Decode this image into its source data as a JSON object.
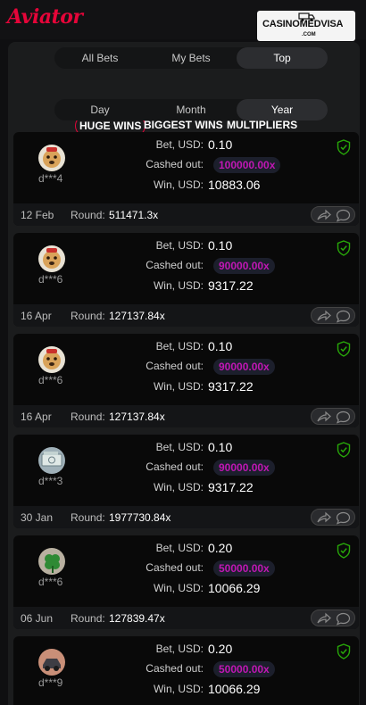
{
  "header": {
    "logo_text": "Aviator",
    "brand_name": "CASINOMEDVISA",
    "brand_domain": ".COM"
  },
  "tabs": {
    "items": [
      "All Bets",
      "My Bets",
      "Top"
    ],
    "active": 2
  },
  "filters": {
    "items": [
      "HUGE WINS",
      "BIGGEST WINS",
      "MULTIPLIERS"
    ],
    "active": 0
  },
  "periods": {
    "items": [
      "Day",
      "Month",
      "Year"
    ],
    "active": 2
  },
  "labels": {
    "bet": "Bet, USD:",
    "cashed_out": "Cashed out:",
    "win": "Win, USD:",
    "round": "Round:"
  },
  "colors": {
    "accent": "#e50539",
    "multiplier": "#c017b4",
    "verified": "#28a909"
  },
  "bets": [
    {
      "user": "d***4",
      "avatar": "dog-avatar",
      "bet": "0.10",
      "cashed_out": "100000.00x",
      "win": "10883.06",
      "date": "12 Feb",
      "round": "511471.3x"
    },
    {
      "user": "d***6",
      "avatar": "dog-avatar",
      "bet": "0.10",
      "cashed_out": "90000.00x",
      "win": "9317.22",
      "date": "16 Apr",
      "round": "127137.84x"
    },
    {
      "user": "d***6",
      "avatar": "dog-avatar",
      "bet": "0.10",
      "cashed_out": "90000.00x",
      "win": "9317.22",
      "date": "16 Apr",
      "round": "127137.84x"
    },
    {
      "user": "d***3",
      "avatar": "money-avatar",
      "bet": "0.10",
      "cashed_out": "90000.00x",
      "win": "9317.22",
      "date": "30 Jan",
      "round": "1977730.84x"
    },
    {
      "user": "d***6",
      "avatar": "clover-avatar",
      "bet": "0.20",
      "cashed_out": "50000.00x",
      "win": "10066.29",
      "date": "06 Jun",
      "round": "127839.47x"
    },
    {
      "user": "d***9",
      "avatar": "car-avatar",
      "bet": "0.20",
      "cashed_out": "50000.00x",
      "win": "10066.29",
      "date": "",
      "round": ""
    }
  ]
}
